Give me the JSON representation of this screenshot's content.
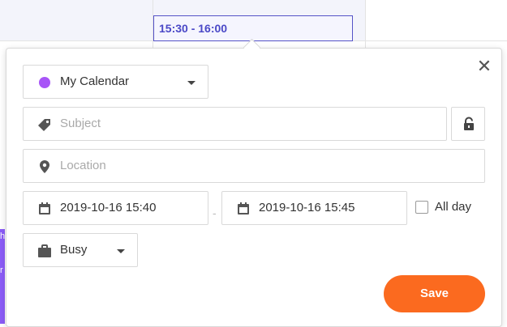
{
  "event_preview": {
    "time_range": "15:30 - 16:00"
  },
  "left_event": {
    "line1": "h",
    "line2": "r"
  },
  "form": {
    "calendar": {
      "label": "My Calendar",
      "color": "#a855f7"
    },
    "subject": {
      "placeholder": "Subject",
      "value": ""
    },
    "location": {
      "placeholder": "Location",
      "value": ""
    },
    "start": "2019-10-16 15:40",
    "separator": "-",
    "end": "2019-10-16 15:45",
    "all_day": {
      "label": "All day",
      "checked": false
    },
    "status": {
      "label": "Busy"
    },
    "save_label": "Save",
    "close_glyph": "✕"
  },
  "colors": {
    "accent": "#fb6a1f",
    "event_border": "#5553c7",
    "left_event": "#8b5cf6"
  }
}
